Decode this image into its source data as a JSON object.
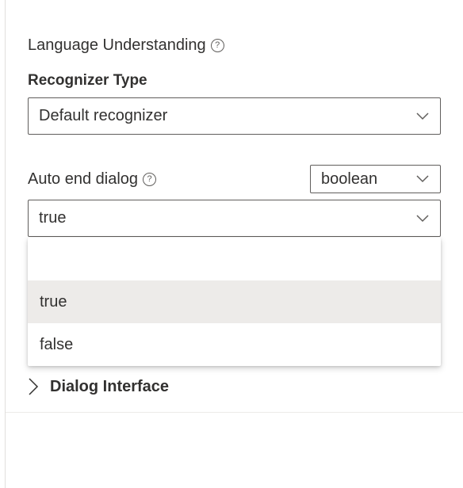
{
  "section": {
    "title": "Language Understanding",
    "help_glyph": "?"
  },
  "recognizer": {
    "label": "Recognizer Type",
    "value": "Default recognizer"
  },
  "auto_end_dialog": {
    "label": "Auto end dialog",
    "help_glyph": "?",
    "type_value": "boolean",
    "value": "true",
    "options": [
      "",
      "true",
      "false"
    ],
    "selected_option": "true"
  },
  "dialog_interface": {
    "label": "Dialog Interface"
  },
  "icons": {
    "help": "help-circle-icon",
    "dropdown": "chevron-down-icon",
    "expand": "chevron-right-icon"
  },
  "colors": {
    "border": "#605e5c",
    "text": "#323130",
    "selected_bg": "#edebe9"
  }
}
